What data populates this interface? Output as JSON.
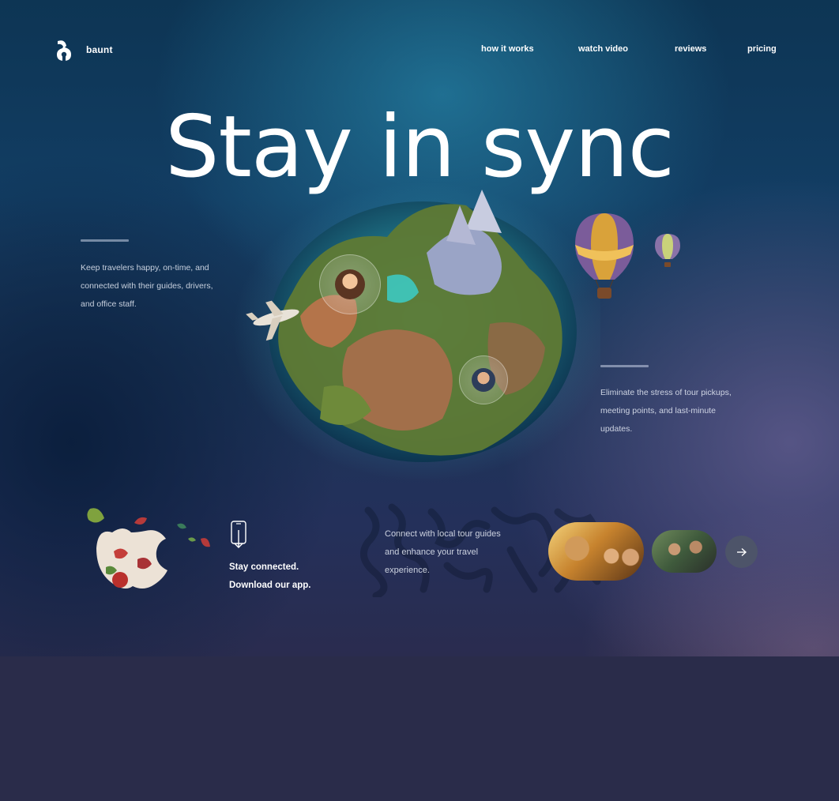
{
  "brand": {
    "name": "baunt",
    "logo_icon": "baunt-logo-icon"
  },
  "nav": {
    "items": [
      {
        "label": "how it works"
      },
      {
        "label": "watch video"
      },
      {
        "label": "reviews"
      },
      {
        "label": "pricing"
      }
    ]
  },
  "hero": {
    "headline": "Stay in sync",
    "left_text_lines": [
      "Keep travelers happy, on-time, and",
      "connected with their guides, drivers,",
      "and office staff."
    ],
    "right_text_lines": [
      "Eliminate the stress of tour pickups,",
      "meeting points, and last-minute",
      "updates."
    ]
  },
  "app": {
    "line1": "Stay connected.",
    "line2": "Download our app.",
    "icon": "phone-download-icon"
  },
  "guides": {
    "text_lines": [
      "Connect with local tour guides",
      "and enhance your travel",
      "experience."
    ],
    "next_icon": "arrow-right-icon"
  },
  "colors": {
    "background_lower": "#2a2c4a",
    "hero_top": "#0d3554",
    "arrow_button": "#4d5469",
    "text": "#ffffff"
  }
}
